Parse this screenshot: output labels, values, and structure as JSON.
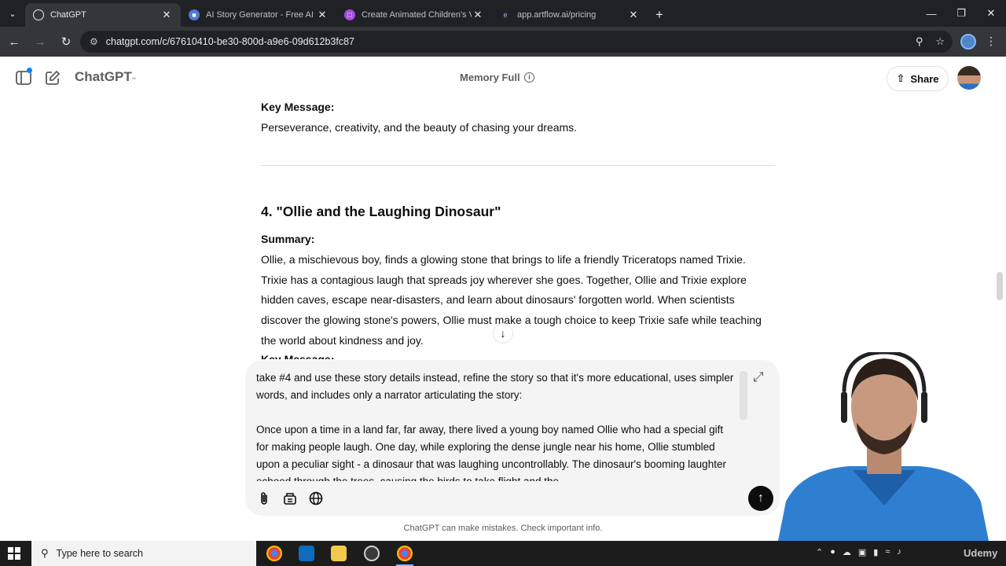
{
  "browser": {
    "tabs": [
      {
        "label": "ChatGPT",
        "active": true,
        "icon": "chatgpt-icon",
        "color": "#ffffff"
      },
      {
        "label": "AI Story Generator - Free AI Sto",
        "active": false,
        "icon": "story-generator-icon",
        "color": "#4f7bd6"
      },
      {
        "label": "Create Animated Children's Vid",
        "active": false,
        "icon": "animated-video-icon",
        "color": "#a34ee0"
      },
      {
        "label": "app.artflow.ai/pricing",
        "active": false,
        "icon": "artflow-icon",
        "color": "#8ab4f8"
      }
    ],
    "url": "chatgpt.com/c/67610410-be30-800d-a9e6-09d612b3fc87"
  },
  "header": {
    "app_name": "ChatGPT",
    "memory_label": "Memory Full",
    "share_label": "Share"
  },
  "conversation": {
    "key_message_label": "Key Message:",
    "key_message_text": "Perseverance, creativity, and the beauty of chasing your dreams.",
    "story4_title": "4. \"Ollie and the Laughing Dinosaur\"",
    "summary_label": "Summary:",
    "summary_text": "Ollie, a mischievous boy, finds a glowing stone that brings to life a friendly Triceratops named Trixie. Trixie has a contagious laugh that spreads joy wherever she goes. Together, Ollie and Trixie explore hidden caves, escape near-disasters, and learn about dinosaurs' forgotten world. When scientists discover the glowing stone's powers, Ollie must make a tough choice to keep Trixie safe while teaching the world about kindness and joy.",
    "partial_label": "Key Message:"
  },
  "composer": {
    "paragraph1": "take #4 and use these story details instead, refine the story so that it's more educational, uses simpler words, and includes only a narrator articulating the story:",
    "paragraph2": "Once upon a time in a land far, far away, there lived a young boy named Ollie who had a special gift for making people laugh. One day, while exploring the dense jungle near his home, Ollie stumbled upon a peculiar sight - a dinosaur that was laughing uncontrollably. The dinosaur's booming laughter echoed through the trees, causing the birds to take flight and the"
  },
  "disclaimer": "ChatGPT can make mistakes. Check important info.",
  "taskbar": {
    "search_placeholder": "Type here to search",
    "watermark": "Udemy"
  }
}
